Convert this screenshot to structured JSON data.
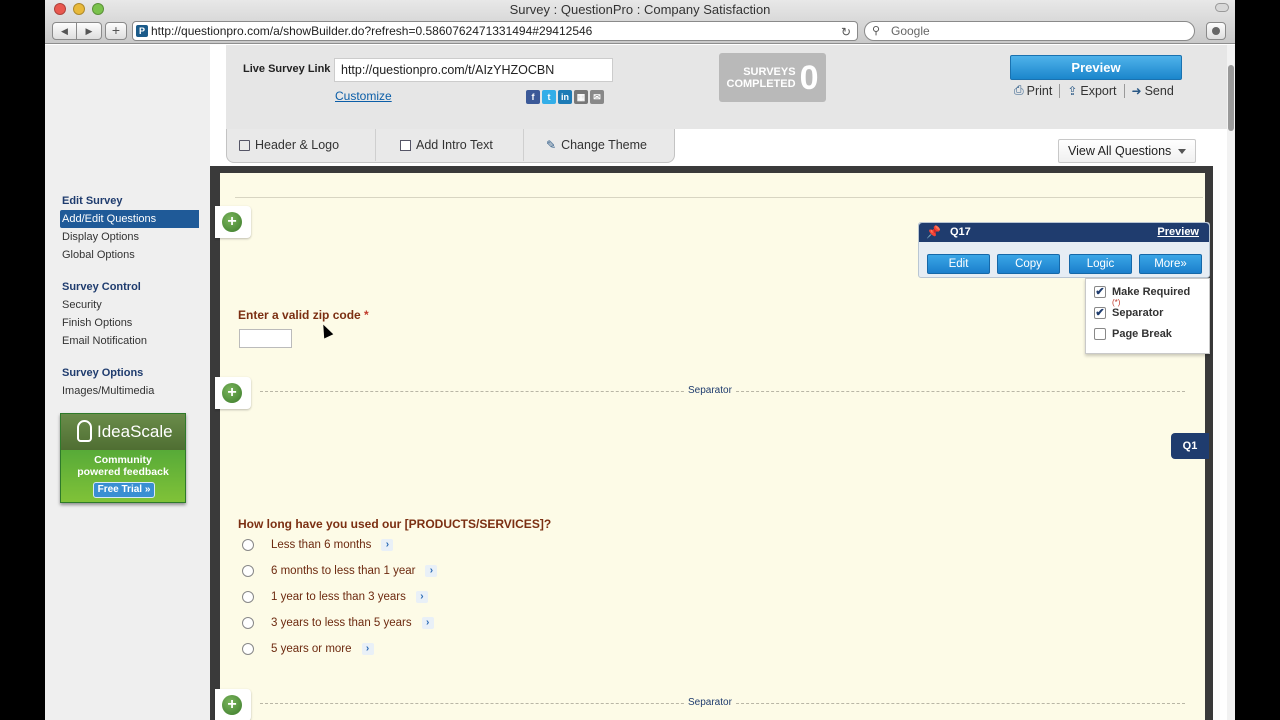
{
  "browser": {
    "title": "Survey : QuestionPro : Company Satisfaction",
    "url": "http://questionpro.com/a/showBuilder.do?refresh=0.5860762471331494#29412546",
    "search_placeholder": "Google"
  },
  "header": {
    "live_survey_link_label": "Live Survey Link",
    "live_survey_link_value": "http://questionpro.com/t/AIzYHZOCBN",
    "customize_label": "Customize",
    "social_icons": [
      "facebook-icon",
      "twitter-icon",
      "linkedin-icon",
      "qr-code-icon",
      "email-icon"
    ],
    "surveys_completed_label_1": "SURVEYS",
    "surveys_completed_label_2": "COMPLETED",
    "surveys_completed_count": "0",
    "preview_label": "Preview",
    "print_label": "Print",
    "export_label": "Export",
    "send_label": "Send",
    "view_all_label": "View All Questions"
  },
  "tabs": [
    {
      "label": "Header & Logo",
      "icon": "header-icon"
    },
    {
      "label": "Add Intro Text",
      "icon": "document-icon"
    },
    {
      "label": "Change Theme",
      "icon": "brush-icon"
    }
  ],
  "sidebar": {
    "sections": [
      {
        "heading": "Edit Survey",
        "items": [
          "Add/Edit Questions",
          "Display Options",
          "Global Options"
        ]
      },
      {
        "heading": "Survey Control",
        "items": [
          "Security",
          "Finish Options",
          "Email Notification"
        ]
      },
      {
        "heading": "Survey Options",
        "items": [
          "Images/Multimedia"
        ]
      }
    ],
    "active_item": "Add/Edit Questions"
  },
  "ideascale": {
    "brand": "IdeaScale",
    "tagline_1": "Community",
    "tagline_2": "powered feedback",
    "cta": "Free Trial »"
  },
  "question_toolbar": {
    "question_number": "Q17",
    "preview_label": "Preview",
    "buttons": [
      "Edit",
      "Copy",
      "Logic",
      "More»"
    ],
    "options": [
      {
        "label": "Make Required",
        "checked": true
      },
      {
        "label": "Separator",
        "checked": true
      },
      {
        "label": "Page Break",
        "checked": false
      }
    ],
    "required_mark": "(*)"
  },
  "questions": {
    "zip": {
      "text": "Enter a valid zip code",
      "required_mark": "*"
    },
    "separator_label": "Separator",
    "q1_tag": "Q1",
    "duration": {
      "text": "How long have you used our [PRODUCTS/SERVICES]?",
      "options": [
        "Less than 6 months",
        "6 months to less than 1 year",
        "1 year to less than 3 years",
        "3 years to less than 5 years",
        "5 years or more"
      ]
    }
  },
  "colors": {
    "navy": "#1f3c6e",
    "button_blue": "#1b86cc",
    "canvas": "#fdfbe7",
    "question_text": "#7b2f12"
  }
}
